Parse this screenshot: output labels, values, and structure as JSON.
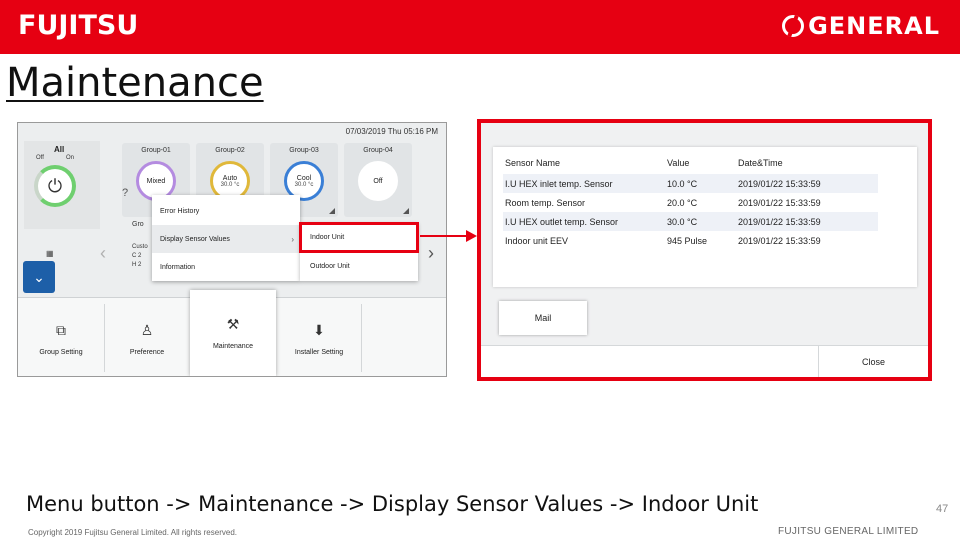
{
  "header": {
    "fujitsu_logo": "FUJITSU",
    "general_logo": "GENERAL",
    "brand_color": "#e60012"
  },
  "page_title": "Maintenance",
  "left_screen": {
    "datetime": "07/03/2019 Thu 05:16 PM",
    "all_panel": {
      "label": "All",
      "off": "Off",
      "on": "On",
      "icon": "power-icon"
    },
    "groups": [
      {
        "name": "Group-01",
        "mode": "Mixed",
        "temp": "",
        "ring_color": "#b48be0"
      },
      {
        "name": "Group-02",
        "mode": "Auto",
        "temp": "30.0 °c",
        "ring_color": "#e0b83a"
      },
      {
        "name": "Group-03",
        "mode": "Cool",
        "temp": "30.0 °c",
        "ring_color": "#3a7fd6"
      },
      {
        "name": "Group-04",
        "mode": "Off",
        "temp": "",
        "ring_color": "#ffffff"
      }
    ],
    "row2_fragment": {
      "group": "Gro",
      "lines": [
        "Custo",
        "C 2",
        "H 2"
      ]
    },
    "menu": {
      "items": [
        {
          "label": "Error History",
          "active": false,
          "has_submenu": false
        },
        {
          "label": "Display Sensor Values",
          "active": true,
          "has_submenu": true
        },
        {
          "label": "Information",
          "active": false,
          "has_submenu": false
        }
      ],
      "submenu": [
        "Indoor Unit",
        "Outdoor Unit"
      ]
    },
    "bottom_nav": [
      {
        "label": "Group Setting",
        "icon": "group-setting-icon",
        "selected": false
      },
      {
        "label": "Preference",
        "icon": "preference-icon",
        "selected": false
      },
      {
        "label": "Maintenance",
        "icon": "maintenance-icon",
        "selected": true
      },
      {
        "label": "Installer Setting",
        "icon": "installer-setting-icon",
        "selected": false
      }
    ]
  },
  "right_screen": {
    "columns": [
      "Sensor Name",
      "Value",
      "Date&Time"
    ],
    "rows": [
      {
        "name": "I.U HEX inlet temp. Sensor",
        "value": "10.0 °C",
        "datetime": "2019/01/22 15:33:59"
      },
      {
        "name": "Room temp. Sensor",
        "value": "20.0 °C",
        "datetime": "2019/01/22 15:33:59"
      },
      {
        "name": "I.U HEX outlet temp. Sensor",
        "value": "30.0 °C",
        "datetime": "2019/01/22 15:33:59"
      },
      {
        "name": "Indoor unit EEV",
        "value": "945 Pulse",
        "datetime": "2019/01/22 15:33:59"
      }
    ],
    "mail_label": "Mail",
    "close_label": "Close"
  },
  "caption": "Menu button -> Maintenance -> Display Sensor Values -> Indoor Unit",
  "page_number": "47",
  "copyright": "Copyright 2019 Fujitsu General Limited. All rights reserved.",
  "company": "FUJITSU GENERAL LIMITED"
}
